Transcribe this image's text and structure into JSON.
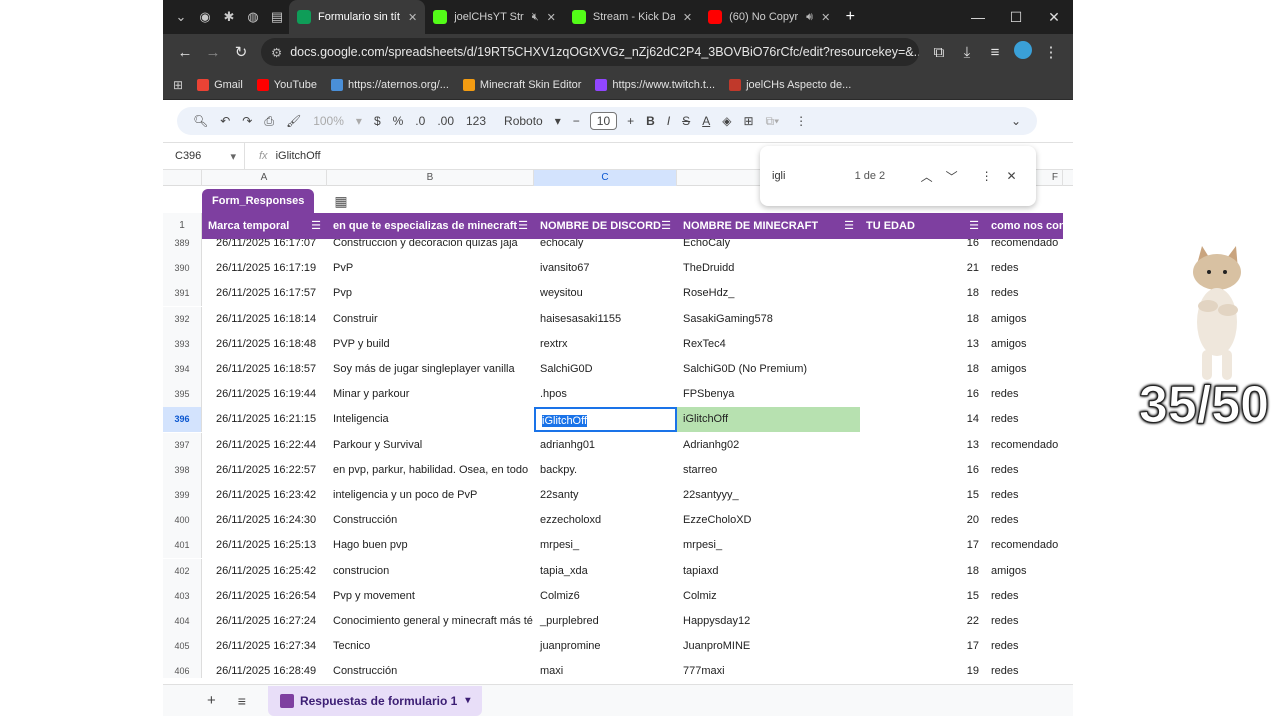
{
  "browser": {
    "tabs": [
      {
        "title": "Formulario sin títu",
        "color": "#0f9d58",
        "active": true
      },
      {
        "title": "joelCHsYT Str",
        "color": "#53fc18",
        "muted": true
      },
      {
        "title": "Stream - Kick Das",
        "color": "#53fc18"
      },
      {
        "title": "(60) No Copyr",
        "color": "#ff0000",
        "audio": true
      }
    ],
    "url": "docs.google.com/spreadsheets/d/19RT5CHXV1zqOGtXVGz_nZj62dC2P4_3BOVBiO76rCfc/edit?resourcekey=&...",
    "bookmarks": [
      {
        "label": "Gmail",
        "color": "#ea4335"
      },
      {
        "label": "YouTube",
        "color": "#ff0000"
      },
      {
        "label": "https://aternos.org/...",
        "color": "#4a8fd8"
      },
      {
        "label": "Minecraft Skin Editor",
        "color": "#f39c12"
      },
      {
        "label": "https://www.twitch.t...",
        "color": "#9146ff"
      },
      {
        "label": "joelCHs Aspecto de...",
        "color": "#c0392b"
      }
    ]
  },
  "toolbar": {
    "zoom": "100%",
    "currency": "$",
    "percent": "%",
    "dec_minus": ".0",
    "dec_plus": ".00",
    "format_123": "123",
    "font": "Roboto",
    "font_size": "10"
  },
  "formula_bar": {
    "cell_ref": "C396",
    "value": "iGlitchOff"
  },
  "find": {
    "query": "igli",
    "count": "1 de 2"
  },
  "columns": {
    "a": "A",
    "b": "B",
    "c": "C",
    "f": "F"
  },
  "table": {
    "name": "Form_Responses",
    "header_row_num": "1",
    "headers": [
      "Marca temporal",
      "en que te especializas de minecraft",
      "NOMBRE DE DISCORD",
      "NOMBRE DE MINECRAFT",
      "TU EDAD",
      "como nos cono"
    ],
    "rows": [
      {
        "n": "389",
        "time": "26/11/2025 16:17:07",
        "spec": "Construccion y decoracion quizas jaja",
        "discord": "echocaly",
        "mc": "EchoCaly",
        "age": "16",
        "how": "recomendado"
      },
      {
        "n": "390",
        "time": "26/11/2025 16:17:19",
        "spec": "PvP",
        "discord": "ivansito67",
        "mc": "TheDruidd",
        "age": "21",
        "how": "redes"
      },
      {
        "n": "391",
        "time": "26/11/2025 16:17:57",
        "spec": "Pvp",
        "discord": "weysitou",
        "mc": "RoseHdz_",
        "age": "18",
        "how": "redes"
      },
      {
        "n": "392",
        "time": "26/11/2025 16:18:14",
        "spec": "Construir",
        "discord": "haisesasaki1155",
        "mc": "SasakiGaming578",
        "age": "18",
        "how": "amigos"
      },
      {
        "n": "393",
        "time": "26/11/2025 16:18:48",
        "spec": "PVP y build",
        "discord": "rextrx",
        "mc": "RexTec4",
        "age": "13",
        "how": "amigos"
      },
      {
        "n": "394",
        "time": "26/11/2025 16:18:57",
        "spec": "Soy más de jugar singleplayer vanilla",
        "discord": "SalchiG0D",
        "mc": "SalchiG0D (No Premium)",
        "age": "18",
        "how": "amigos"
      },
      {
        "n": "395",
        "time": "26/11/2025 16:19:44",
        "spec": "Minar y parkour",
        "discord": ".hpos",
        "mc": "FPSbenya",
        "age": "16",
        "how": "redes"
      },
      {
        "n": "396",
        "time": "26/11/2025 16:21:15",
        "spec": "Inteligencia",
        "discord": "iGlitchOff",
        "mc": "iGlitchOff",
        "age": "14",
        "how": "redes"
      },
      {
        "n": "397",
        "time": "26/11/2025 16:22:44",
        "spec": "Parkour y Survival",
        "discord": "adrianhg01",
        "mc": "Adrianhg02",
        "age": "13",
        "how": "recomendado"
      },
      {
        "n": "398",
        "time": "26/11/2025 16:22:57",
        "spec": "en pvp, parkur, habilidad. Osea, en todo",
        "discord": "backpy.",
        "mc": "starreo",
        "age": "16",
        "how": "redes"
      },
      {
        "n": "399",
        "time": "26/11/2025 16:23:42",
        "spec": "inteligencia y un poco de PvP",
        "discord": "22santy",
        "mc": "22santyyy_",
        "age": "15",
        "how": "redes"
      },
      {
        "n": "400",
        "time": "26/11/2025 16:24:30",
        "spec": "Construcción",
        "discord": "ezzecholoxd",
        "mc": "EzzeCholoXD",
        "age": "20",
        "how": "redes"
      },
      {
        "n": "401",
        "time": "26/11/2025 16:25:13",
        "spec": "Hago buen pvp",
        "discord": "mrpesi_",
        "mc": "mrpesi_",
        "age": "17",
        "how": "recomendado"
      },
      {
        "n": "402",
        "time": "26/11/2025 16:25:42",
        "spec": "construcion",
        "discord": "tapia_xda",
        "mc": "tapiaxd",
        "age": "18",
        "how": "amigos"
      },
      {
        "n": "403",
        "time": "26/11/2025 16:26:54",
        "spec": "Pvp y movement",
        "discord": "Colmiz6",
        "mc": "Colmiz",
        "age": "15",
        "how": "redes"
      },
      {
        "n": "404",
        "time": "26/11/2025 16:27:24",
        "spec": "Conocimiento general y minecraft más té",
        "discord": "_purplebred",
        "mc": "Happysday12",
        "age": "22",
        "how": "redes"
      },
      {
        "n": "405",
        "time": "26/11/2025 16:27:34",
        "spec": "Tecnico",
        "discord": "juanpromine",
        "mc": "JuanproMINE",
        "age": "17",
        "how": "redes"
      },
      {
        "n": "406",
        "time": "26/11/2025 16:28:49",
        "spec": "Construcción",
        "discord": "maxi",
        "mc": "777maxi",
        "age": "19",
        "how": "redes"
      }
    ]
  },
  "sheet_tab": {
    "label": "Respuestas de formulario 1"
  },
  "overlay": {
    "counter": "35/50"
  }
}
